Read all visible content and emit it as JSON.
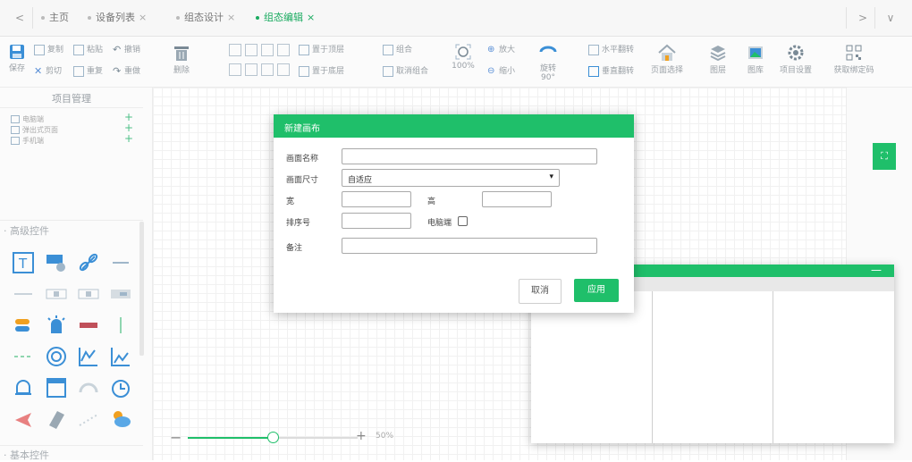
{
  "tabs": [
    {
      "label": "主页",
      "closable": false,
      "active": false
    },
    {
      "label": "设备列表",
      "closable": true,
      "active": false
    },
    {
      "label": "组态设计",
      "closable": true,
      "active": false
    },
    {
      "label": "组态编辑",
      "closable": true,
      "active": true
    }
  ],
  "tab_close_glyph": "×",
  "nav": {
    "prev": "<",
    "next": ">",
    "menu": "∨"
  },
  "toolbar": {
    "save": "保存",
    "copy": "复制",
    "paste": "粘贴",
    "undo": "撤销",
    "cut": "剪切",
    "redo": "重复",
    "redo2": "重做",
    "delete": "删除",
    "bring_to_top": "置于顶层",
    "group": "组合",
    "send_to_bottom": "置于底层",
    "ungroup": "取消组合",
    "zoom_percent": "100%",
    "zoom_in": "放大",
    "zoom_out": "缩小",
    "rotate": "旋转90°",
    "align_h": "水平翻转",
    "align_v": "垂直翻转",
    "page_select": "页面选择",
    "layer": "图层",
    "gallery": "图库",
    "project_settings": "项目设置",
    "get_qrcode": "获取绑定码"
  },
  "left_panel": {
    "project_title": "项目管理",
    "items": [
      "电脑端",
      "弹出式页面",
      "手机端"
    ],
    "advanced_title": "高级控件",
    "basic_title": "基本控件"
  },
  "zoom": {
    "value": "50%",
    "level": 0.5
  },
  "dialog": {
    "title": "新建画布",
    "name_label": "画面名称",
    "name_value": "",
    "size_label": "画面尺寸",
    "size_value": "自适应",
    "width_label": "宽",
    "width_value": "",
    "height_label": "高",
    "height_value": "",
    "order_label": "排序号",
    "order_value": "",
    "pc_label": "电脑端",
    "pc_checked": false,
    "remark_label": "备注",
    "remark_value": "",
    "cancel": "取消",
    "apply": "应用"
  },
  "colors": {
    "accent": "#1fbf6a",
    "icon_blue": "#3b8fd6",
    "icon_orange": "#f0a020"
  }
}
